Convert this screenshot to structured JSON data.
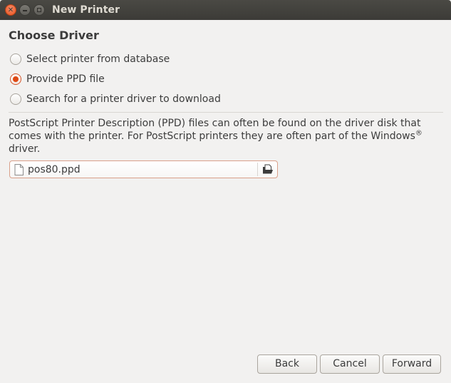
{
  "window": {
    "title": "New Printer"
  },
  "page": {
    "heading": "Choose Driver"
  },
  "options": [
    {
      "label": "Select printer from database",
      "checked": false
    },
    {
      "label": "Provide PPD file",
      "checked": true
    },
    {
      "label": "Search for a printer driver to download",
      "checked": false
    }
  ],
  "description": {
    "text": "PostScript Printer Description (PPD) files can often be found on the driver disk that comes with the printer. For PostScript printers they are often part of the Windows",
    "superscript": "®",
    "tail": " driver."
  },
  "file_chooser": {
    "value": "pos80.ppd",
    "file_icon": "document-icon",
    "open_icon": "document-open-icon"
  },
  "buttons": {
    "back": "Back",
    "cancel": "Cancel",
    "forward": "Forward"
  },
  "colors": {
    "accent": "#dd4814",
    "titlebar": "#3c3b37",
    "background": "#f2f1f0"
  }
}
